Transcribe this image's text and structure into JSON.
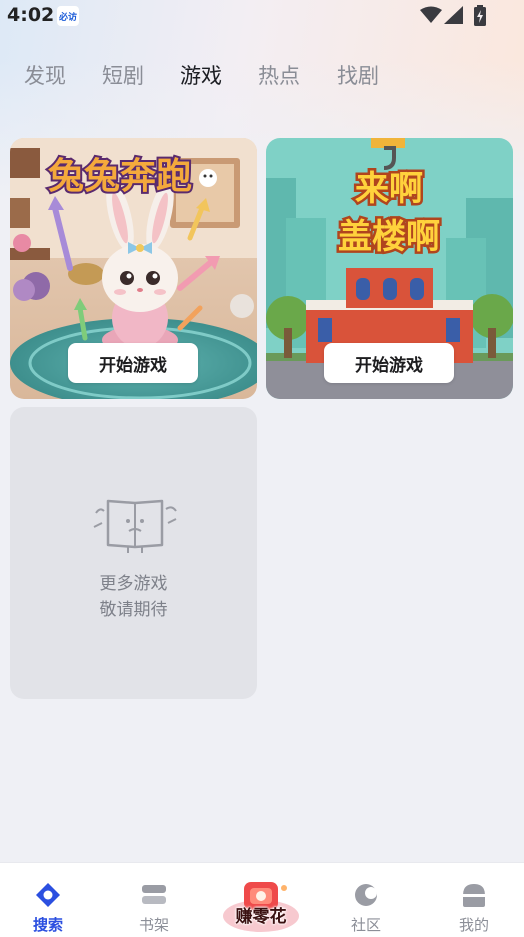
{
  "status_bar": {
    "time": "4:02",
    "notification_app": "必访"
  },
  "tabs": [
    {
      "label": "发现",
      "active": false
    },
    {
      "label": "短剧",
      "active": false
    },
    {
      "label": "游戏",
      "active": true
    },
    {
      "label": "热点",
      "active": false
    },
    {
      "label": "找剧",
      "active": false
    }
  ],
  "games": [
    {
      "title": "兔兔奔跑",
      "button": "开始游戏"
    },
    {
      "title": "来啊盖楼啊",
      "button": "开始游戏"
    }
  ],
  "more_games": {
    "line1": "更多游戏",
    "line2": "敬请期待"
  },
  "bottom_nav": {
    "search": "搜索",
    "bookshelf": "书架",
    "earn": "赚零花",
    "community": "社区",
    "mine": "我的"
  },
  "colors": {
    "accent": "#2b4fe0",
    "active_tab": "#1b1d22",
    "inactive_tab": "#8a8d96"
  }
}
